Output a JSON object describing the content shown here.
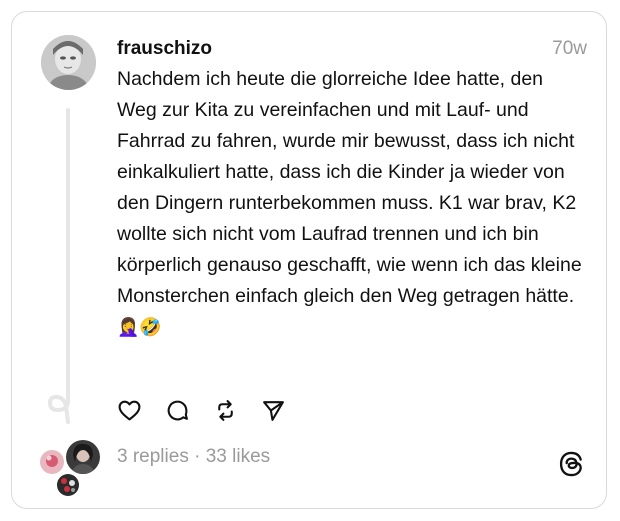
{
  "post": {
    "username": "frauschizo",
    "timestamp": "70w",
    "body": "Nachdem ich heute die glorreiche Idee hatte, den Weg zur Kita zu vereinfachen und mit Lauf- und Fahrrad zu fahren, wurde mir bewusst, dass ich nicht einkalkuliert hatte, dass ich die Kinder ja wieder von den Dingern runterbekommen muss. K1 war brav, K2 wollte sich nicht vom Laufrad trennen und ich bin körperlich genauso geschafft, wie wenn ich das kleine Monsterchen einfach gleich den Weg getragen hätte.",
    "emojis": "🤦‍♀️🤣"
  },
  "actions": {
    "like_icon": "heart-icon",
    "comment_icon": "comment-icon",
    "repost_icon": "repost-icon",
    "share_icon": "send-icon"
  },
  "stats": {
    "replies": "3 replies",
    "separator": "·",
    "likes": "33 likes"
  },
  "colors": {
    "text": "#111111",
    "muted": "#9a9a9a",
    "border": "#d9d9d9"
  }
}
